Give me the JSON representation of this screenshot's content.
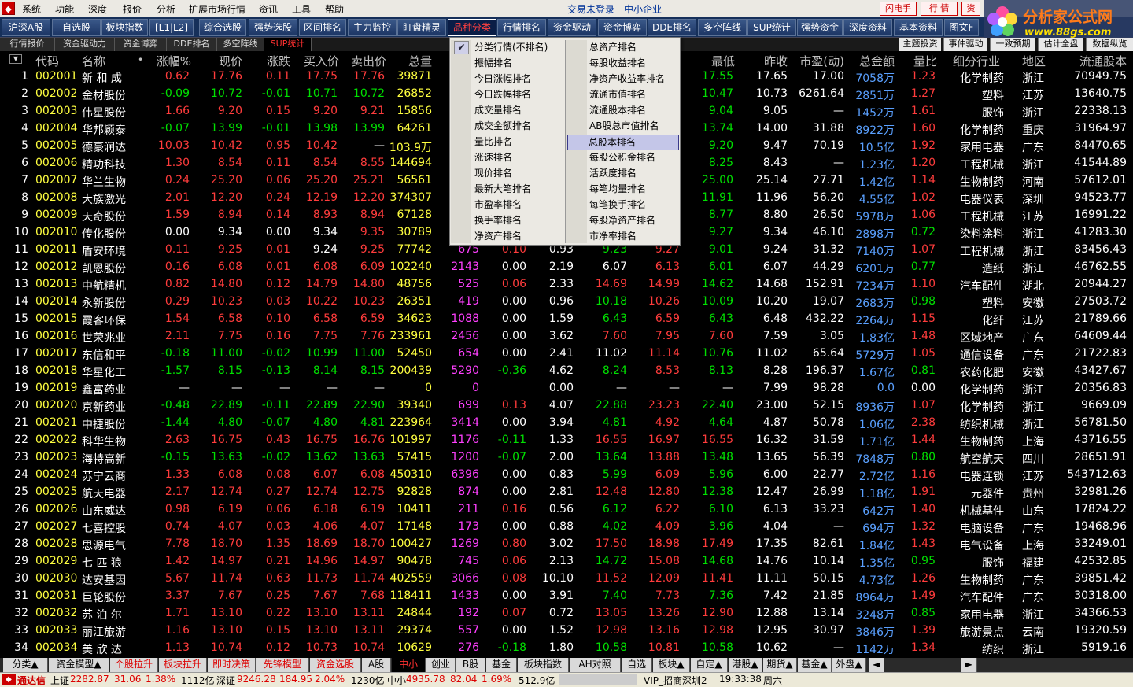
{
  "menu": {
    "items": [
      "系统",
      "功能",
      "深度",
      "报价",
      "分析",
      "扩展市场行情",
      "资讯",
      "工具",
      "帮助"
    ],
    "center_text": "交易未登录",
    "market_name": "中小企业",
    "right_buttons": [
      "闪电手",
      "行 情",
      "资"
    ]
  },
  "watermark": {
    "line1": "分析家公式网",
    "line2": "www.88gs.com"
  },
  "toolbar": [
    "沪深A股",
    "自选股",
    "板块指数",
    "[L1|L2]",
    "综合选股",
    "强势选股",
    "区间排名",
    "主力监控",
    "盯盘精灵",
    "品种分类",
    "行情排名",
    "资金驱动",
    "资金博弈",
    "DDE排名",
    "多空阵线",
    "SUP统计",
    "强势资金",
    "深度资料",
    "基本资料",
    "图文F"
  ],
  "toolbar_active": 9,
  "subtabs": [
    "行情报价",
    "资金驱动力",
    "资金博弈",
    "DDE排名",
    "多空阵线",
    "SUP统计"
  ],
  "subtabs_active": 5,
  "subtabs_right": [
    "主题投资",
    "事件驱动",
    "一致预期",
    "估计全盘",
    "数据纵览"
  ],
  "table": {
    "headers": [
      "代码",
      "名称",
      "涨幅%",
      "现价",
      "涨跌",
      "买入价",
      "卖出价",
      "总量",
      "最低",
      "昨收",
      "市盈(动)",
      "总金额",
      "量比",
      "细分行业",
      "地区",
      "流通股本"
    ],
    "header_dot": "•",
    "rows": [
      [
        "1",
        "002001",
        "新 和 成",
        "0.62",
        "17.76",
        "0.11",
        "17.75",
        "17.76",
        "39871",
        "",
        "",
        "",
        "",
        "",
        "",
        "17.55",
        "17.65",
        "17.00",
        "7058万",
        "1.23",
        "化学制药",
        "浙江",
        "70949.75"
      ],
      [
        "2",
        "002002",
        "金材股份",
        "-0.09",
        "10.72",
        "-0.01",
        "10.71",
        "10.72",
        "26852",
        "",
        "",
        "",
        "",
        "",
        "",
        "10.47",
        "10.73",
        "6261.64",
        "2851万",
        "1.27",
        "塑料",
        "江苏",
        "13640.75"
      ],
      [
        "3",
        "002003",
        "伟星股份",
        "1.66",
        "9.20",
        "0.15",
        "9.20",
        "9.21",
        "15856",
        "",
        "",
        "",
        "",
        "",
        "",
        "9.04",
        "9.05",
        "—",
        "1452万",
        "1.61",
        "服饰",
        "浙江",
        "22338.13"
      ],
      [
        "4",
        "002004",
        "华邦颖泰",
        "-0.07",
        "13.99",
        "-0.01",
        "13.98",
        "13.99",
        "64261",
        "",
        "",
        "",
        "",
        "",
        "",
        "13.74",
        "14.00",
        "31.88",
        "8922万",
        "1.60",
        "化学制药",
        "重庆",
        "31964.97"
      ],
      [
        "5",
        "002005",
        "德豪润达",
        "10.03",
        "10.42",
        "0.95",
        "10.42",
        "—",
        "103.9万",
        "",
        "",
        "",
        "",
        "",
        "",
        "9.20",
        "9.47",
        "70.19",
        "10.5亿",
        "1.92",
        "家用电器",
        "广东",
        "84470.65"
      ],
      [
        "6",
        "002006",
        "精功科技",
        "1.30",
        "8.54",
        "0.11",
        "8.54",
        "8.55",
        "144694",
        "",
        "",
        "",
        "",
        "",
        "",
        "8.25",
        "8.43",
        "—",
        "1.23亿",
        "1.20",
        "工程机械",
        "浙江",
        "41544.89"
      ],
      [
        "7",
        "002007",
        "华兰生物",
        "0.24",
        "25.20",
        "0.06",
        "25.20",
        "25.21",
        "56561",
        "",
        "",
        "",
        "",
        "",
        "",
        "25.00",
        "25.14",
        "27.71",
        "1.42亿",
        "1.14",
        "生物制药",
        "河南",
        "57612.01"
      ],
      [
        "8",
        "002008",
        "大族激光",
        "2.01",
        "12.20",
        "0.24",
        "12.19",
        "12.20",
        "374307",
        "",
        "",
        "",
        "",
        "",
        "",
        "11.91",
        "11.96",
        "56.20",
        "4.55亿",
        "1.02",
        "电器仪表",
        "深圳",
        "94523.77"
      ],
      [
        "9",
        "002009",
        "天奇股份",
        "1.59",
        "8.94",
        "0.14",
        "8.93",
        "8.94",
        "67128",
        "",
        "",
        "",
        "",
        "",
        "",
        "8.77",
        "8.80",
        "26.50",
        "5978万",
        "1.06",
        "工程机械",
        "江苏",
        "16991.22"
      ],
      [
        "10",
        "002010",
        "传化股份",
        "0.00",
        "9.34",
        "0.00",
        "9.34",
        "9.35",
        "30789",
        "",
        "",
        "",
        "",
        "",
        "",
        "9.27",
        "9.34",
        "46.10",
        "2898万",
        "0.72",
        "染料涂料",
        "浙江",
        "41283.30"
      ],
      [
        "11",
        "002011",
        "盾安环境",
        "0.11",
        "9.25",
        "0.01",
        "9.24",
        "9.25",
        "77742",
        "675",
        "0.10",
        "0.93",
        "9.23",
        "9.27",
        "",
        "9.01",
        "9.24",
        "31.32",
        "7140万",
        "1.07",
        "工程机械",
        "浙江",
        "83456.43"
      ],
      [
        "12",
        "002012",
        "凯恩股份",
        "0.16",
        "6.08",
        "0.01",
        "6.08",
        "6.09",
        "102240",
        "2143",
        "0.00",
        "2.19",
        "6.07",
        "6.13",
        "",
        "6.01",
        "6.07",
        "44.29",
        "6201万",
        "0.77",
        "造纸",
        "浙江",
        "46762.55"
      ],
      [
        "13",
        "002013",
        "中航精机",
        "0.82",
        "14.80",
        "0.12",
        "14.79",
        "14.80",
        "48756",
        "525",
        "0.06",
        "2.33",
        "14.69",
        "14.99",
        "",
        "14.62",
        "14.68",
        "152.91",
        "7234万",
        "1.10",
        "汽车配件",
        "湖北",
        "20944.27"
      ],
      [
        "14",
        "002014",
        "永新股份",
        "0.29",
        "10.23",
        "0.03",
        "10.22",
        "10.23",
        "26351",
        "419",
        "0.00",
        "0.96",
        "10.18",
        "10.26",
        "",
        "10.09",
        "10.20",
        "19.07",
        "2683万",
        "0.98",
        "塑料",
        "安徽",
        "27503.72"
      ],
      [
        "15",
        "002015",
        "霞客环保",
        "1.54",
        "6.58",
        "0.10",
        "6.58",
        "6.59",
        "34623",
        "1088",
        "0.00",
        "1.59",
        "6.43",
        "6.59",
        "",
        "6.43",
        "6.48",
        "432.22",
        "2264万",
        "1.15",
        "化纤",
        "江苏",
        "21789.66"
      ],
      [
        "16",
        "002016",
        "世荣兆业",
        "2.11",
        "7.75",
        "0.16",
        "7.75",
        "7.76",
        "233961",
        "2456",
        "0.00",
        "3.62",
        "7.60",
        "7.95",
        "",
        "7.60",
        "7.59",
        "3.05",
        "1.83亿",
        "1.48",
        "区域地产",
        "广东",
        "64609.44"
      ],
      [
        "17",
        "002017",
        "东信和平",
        "-0.18",
        "11.00",
        "-0.02",
        "10.99",
        "11.00",
        "52450",
        "654",
        "0.00",
        "2.41",
        "11.02",
        "11.14",
        "",
        "10.76",
        "11.02",
        "65.64",
        "5729万",
        "1.05",
        "通信设备",
        "广东",
        "21722.83"
      ],
      [
        "18",
        "002018",
        "华星化工",
        "-1.57",
        "8.15",
        "-0.13",
        "8.14",
        "8.15",
        "200439",
        "5290",
        "-0.36",
        "4.62",
        "8.24",
        "8.53",
        "",
        "8.13",
        "8.28",
        "196.37",
        "1.67亿",
        "0.81",
        "农药化肥",
        "安徽",
        "43427.67"
      ],
      [
        "19",
        "002019",
        "鑫富药业",
        "—",
        "—",
        "—",
        "—",
        "—",
        "0",
        "0",
        "",
        "0.00",
        "—",
        "—",
        "",
        "—",
        "7.99",
        "98.28",
        "0.0",
        "0.00",
        "化学制药",
        "浙江",
        "20356.83"
      ],
      [
        "20",
        "002020",
        "京新药业",
        "-0.48",
        "22.89",
        "-0.11",
        "22.89",
        "22.90",
        "39340",
        "699",
        "0.13",
        "4.07",
        "22.88",
        "23.23",
        "",
        "22.40",
        "23.00",
        "52.15",
        "8936万",
        "1.07",
        "化学制药",
        "浙江",
        "9669.09"
      ],
      [
        "21",
        "002021",
        "中捷股份",
        "-1.44",
        "4.80",
        "-0.07",
        "4.80",
        "4.81",
        "223964",
        "3414",
        "0.00",
        "3.94",
        "4.81",
        "4.92",
        "",
        "4.64",
        "4.87",
        "50.78",
        "1.06亿",
        "2.38",
        "纺织机械",
        "浙江",
        "56781.50"
      ],
      [
        "22",
        "002022",
        "科华生物",
        "2.63",
        "16.75",
        "0.43",
        "16.75",
        "16.76",
        "101997",
        "1176",
        "-0.11",
        "1.33",
        "16.55",
        "16.97",
        "",
        "16.55",
        "16.32",
        "31.59",
        "1.71亿",
        "1.44",
        "生物制药",
        "上海",
        "43716.55"
      ],
      [
        "23",
        "002023",
        "海特高新",
        "-0.15",
        "13.63",
        "-0.02",
        "13.62",
        "13.63",
        "57415",
        "1200",
        "-0.07",
        "2.00",
        "13.64",
        "13.88",
        "",
        "13.48",
        "13.65",
        "56.39",
        "7848万",
        "0.80",
        "航空航天",
        "四川",
        "28651.91"
      ],
      [
        "24",
        "002024",
        "苏宁云商",
        "1.33",
        "6.08",
        "0.08",
        "6.07",
        "6.08",
        "450310",
        "6396",
        "0.00",
        "0.83",
        "5.99",
        "6.09",
        "",
        "5.96",
        "6.00",
        "22.77",
        "2.72亿",
        "1.16",
        "电器连锁",
        "江苏",
        "543712.63"
      ],
      [
        "25",
        "002025",
        "航天电器",
        "2.17",
        "12.74",
        "0.27",
        "12.74",
        "12.75",
        "92828",
        "874",
        "0.00",
        "2.81",
        "12.48",
        "12.80",
        "",
        "12.38",
        "12.47",
        "26.99",
        "1.18亿",
        "1.91",
        "元器件",
        "贵州",
        "32981.26"
      ],
      [
        "26",
        "002026",
        "山东威达",
        "0.98",
        "6.19",
        "0.06",
        "6.18",
        "6.19",
        "10411",
        "211",
        "0.16",
        "0.56",
        "6.12",
        "6.22",
        "",
        "6.10",
        "6.13",
        "33.23",
        "642万",
        "1.40",
        "机械基件",
        "山东",
        "17824.22"
      ],
      [
        "27",
        "002027",
        "七喜控股",
        "0.74",
        "4.07",
        "0.03",
        "4.06",
        "4.07",
        "17148",
        "173",
        "0.00",
        "0.88",
        "4.02",
        "4.09",
        "",
        "3.96",
        "4.04",
        "—",
        "694万",
        "1.32",
        "电脑设备",
        "广东",
        "19468.96"
      ],
      [
        "28",
        "002028",
        "思源电气",
        "7.78",
        "18.70",
        "1.35",
        "18.69",
        "18.70",
        "100427",
        "1269",
        "0.80",
        "3.02",
        "17.50",
        "18.98",
        "",
        "17.49",
        "17.35",
        "82.61",
        "1.84亿",
        "1.43",
        "电气设备",
        "上海",
        "33249.01"
      ],
      [
        "29",
        "002029",
        "七 匹 狼",
        "1.42",
        "14.97",
        "0.21",
        "14.96",
        "14.97",
        "90478",
        "745",
        "0.06",
        "2.13",
        "14.72",
        "15.08",
        "",
        "14.68",
        "14.76",
        "10.14",
        "1.35亿",
        "0.95",
        "服饰",
        "福建",
        "42532.85"
      ],
      [
        "30",
        "002030",
        "达安基因",
        "5.67",
        "11.74",
        "0.63",
        "11.73",
        "11.74",
        "402559",
        "3066",
        "0.08",
        "10.10",
        "11.52",
        "12.09",
        "",
        "11.41",
        "11.11",
        "50.15",
        "4.73亿",
        "1.26",
        "生物制药",
        "广东",
        "39851.42"
      ],
      [
        "31",
        "002031",
        "巨轮股份",
        "3.37",
        "7.67",
        "0.25",
        "7.67",
        "7.68",
        "118411",
        "1433",
        "0.00",
        "3.91",
        "7.40",
        "7.73",
        "",
        "7.36",
        "7.42",
        "21.85",
        "8964万",
        "1.49",
        "汽车配件",
        "广东",
        "30318.00"
      ],
      [
        "32",
        "002032",
        "苏 泊 尔",
        "1.71",
        "13.10",
        "0.22",
        "13.10",
        "13.11",
        "24844",
        "192",
        "0.07",
        "0.72",
        "13.05",
        "13.26",
        "",
        "12.90",
        "12.88",
        "13.14",
        "3248万",
        "0.85",
        "家用电器",
        "浙江",
        "34366.53"
      ],
      [
        "33",
        "002033",
        "丽江旅游",
        "1.16",
        "13.10",
        "0.15",
        "13.10",
        "13.11",
        "29374",
        "557",
        "0.00",
        "1.52",
        "12.98",
        "13.16",
        "",
        "12.98",
        "12.95",
        "30.97",
        "3846万",
        "1.39",
        "旅游景点",
        "云南",
        "19320.59"
      ],
      [
        "34",
        "002034",
        "美 欣 达",
        "1.13",
        "10.74",
        "0.12",
        "10.73",
        "10.74",
        "10629",
        "276",
        "-0.18",
        "1.80",
        "10.58",
        "10.81",
        "",
        "10.58",
        "10.62",
        "—",
        "1142万",
        "1.34",
        "纺织",
        "浙江",
        "5919.16"
      ]
    ]
  },
  "dropdown": {
    "check_mark": "✔",
    "left": [
      "分类行情(不排名)",
      "振幅排名",
      "今日涨幅排名",
      "今日跌幅排名",
      "成交量排名",
      "成交金额排名",
      "量比排名",
      "涨速排名",
      "现价排名",
      "最新大笔排名",
      "市盈率排名",
      "换手率排名",
      "净资产排名"
    ],
    "right": [
      "总资产排名",
      "每股收益排名",
      "净资产收益率排名",
      "流通市值排名",
      "流通股本排名",
      "AB股总市值排名",
      "总股本排名",
      "每股公积金排名",
      "活跃度排名",
      "每笔均量排名",
      "每笔换手排名",
      "每股净资产排名",
      "市净率排名"
    ],
    "highlight_right": 6
  },
  "bottom_tabs": [
    "分类▲",
    "资金模型▲",
    "个股拉升",
    "板块拉升",
    "即时决策",
    "先锋模型",
    "资金选股",
    "A股",
    "中小",
    "创业",
    "B股",
    "基金",
    "板块指数",
    "AH对照",
    "自选",
    "板块▲",
    "自定▲",
    "港股▲",
    "期货▲",
    "基金▲",
    "外盘▲"
  ],
  "bottom_active": 8,
  "status": {
    "brand": "通达信",
    "sh_label": "上证",
    "sh_index": "2282.87",
    "sh_change": "31.06",
    "sh_pct": "1.38%",
    "sh_amount": "1112亿",
    "sz_label": "深证",
    "sz_index": "9246.28",
    "sz_change": "184.95",
    "sz_pct": "2.04%",
    "sz_amount": "1230亿",
    "zx_label": "中小",
    "zx_index": "4935.78",
    "zx_change": "82.04",
    "zx_pct": "1.69%",
    "zx_amount": "512.9亿",
    "server": "VIP_招商深圳2",
    "time": "19:33:38",
    "weekday": "周六"
  },
  "colors": {
    "up": "#ff3c3c",
    "down": "#00e000",
    "flat": "#ffffff",
    "code": "#ffff40",
    "amount": "#5aa0ff",
    "volume": "#ffff40",
    "tick": "#ff40ff"
  }
}
